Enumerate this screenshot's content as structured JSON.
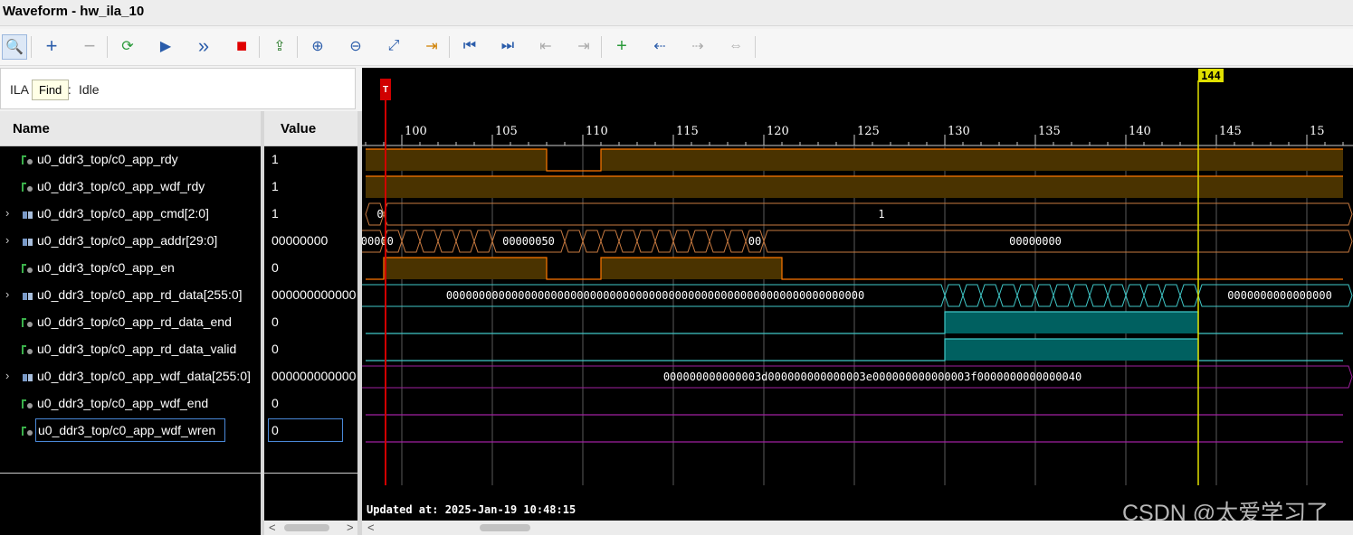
{
  "window": {
    "title": "Waveform - hw_ila_10"
  },
  "toolbar": {
    "buttons": [
      {
        "icon": "search-icon",
        "glyph": "🔍"
      },
      {
        "icon": "add-icon",
        "glyph": "+"
      },
      {
        "icon": "remove-icon",
        "glyph": "−"
      },
      {
        "icon": "run-trigger-immediate-icon",
        "glyph": "⟳"
      },
      {
        "icon": "run-icon",
        "glyph": "▶"
      },
      {
        "icon": "fast-forward-icon",
        "glyph": "»"
      },
      {
        "icon": "stop-icon",
        "glyph": "■"
      },
      {
        "icon": "export-icon",
        "glyph": "⇪"
      },
      {
        "icon": "zoom-in-icon",
        "glyph": "⊕"
      },
      {
        "icon": "zoom-out-icon",
        "glyph": "⊖"
      },
      {
        "icon": "zoom-fit-icon",
        "glyph": "⤢"
      },
      {
        "icon": "goto-cursor-icon",
        "glyph": "⇥"
      },
      {
        "icon": "goto-start-icon",
        "glyph": "⏮"
      },
      {
        "icon": "goto-end-icon",
        "glyph": "⏭"
      },
      {
        "icon": "previous-transition-icon",
        "glyph": "⇤"
      },
      {
        "icon": "next-transition-icon",
        "glyph": "⇥"
      },
      {
        "icon": "add-marker-icon",
        "glyph": "+"
      },
      {
        "icon": "previous-marker-icon",
        "glyph": "⇠"
      },
      {
        "icon": "next-marker-icon",
        "glyph": "⇢"
      },
      {
        "icon": "swap-cursors-icon",
        "glyph": "⇔"
      }
    ]
  },
  "status": {
    "label": "ILA Status:",
    "value": "Idle",
    "tooltip": "Find"
  },
  "columns": {
    "name": "Name",
    "value": "Value"
  },
  "signals": [
    {
      "name": "u0_ddr3_top/c0_app_rdy",
      "value": "1",
      "type": "bit",
      "expandable": false
    },
    {
      "name": "u0_ddr3_top/c0_app_wdf_rdy",
      "value": "1",
      "type": "bit",
      "expandable": false
    },
    {
      "name": "u0_ddr3_top/c0_app_cmd[2:0]",
      "value": "1",
      "type": "bus",
      "expandable": true
    },
    {
      "name": "u0_ddr3_top/c0_app_addr[29:0]",
      "value": "00000000",
      "type": "bus",
      "expandable": true
    },
    {
      "name": "u0_ddr3_top/c0_app_en",
      "value": "0",
      "type": "bit",
      "expandable": false
    },
    {
      "name": "u0_ddr3_top/c0_app_rd_data[255:0]",
      "value": "000000000000",
      "type": "bus",
      "expandable": true
    },
    {
      "name": "u0_ddr3_top/c0_app_rd_data_end",
      "value": "0",
      "type": "bit",
      "expandable": false
    },
    {
      "name": "u0_ddr3_top/c0_app_rd_data_valid",
      "value": "0",
      "type": "bit",
      "expandable": false
    },
    {
      "name": "u0_ddr3_top/c0_app_wdf_data[255:0]",
      "value": "000000000000",
      "type": "bus",
      "expandable": true
    },
    {
      "name": "u0_ddr3_top/c0_app_wdf_end",
      "value": "0",
      "type": "bit",
      "expandable": false
    },
    {
      "name": "u0_ddr3_top/c0_app_wdf_wren",
      "value": "0",
      "type": "bit",
      "expandable": false,
      "selected": true
    }
  ],
  "timeline": {
    "start": 98,
    "end": 152,
    "labels": [
      "100",
      "105",
      "110",
      "115",
      "120",
      "125",
      "130",
      "135",
      "140",
      "145",
      "15"
    ],
    "trigger_marker": {
      "label": "T",
      "time": 99
    },
    "cursor": {
      "label": "144",
      "time": 144
    }
  },
  "waves": {
    "c0_app_rdy": {
      "high": [
        [
          98,
          108
        ],
        [
          111,
          152
        ]
      ]
    },
    "c0_app_wdf_rdy": {
      "high": [
        [
          98,
          152
        ]
      ]
    },
    "c0_app_en": {
      "high": [
        [
          99,
          108
        ],
        [
          111,
          121
        ]
      ]
    },
    "c0_app_rd_data_end": {
      "high": [
        [
          130,
          144
        ]
      ]
    },
    "c0_app_rd_data_valid": {
      "high": [
        [
          130,
          144
        ]
      ]
    },
    "c0_app_cmd": {
      "labels": [
        "0",
        "1"
      ]
    },
    "c0_app_addr": {
      "labels": [
        "00000000",
        "00000050",
        "00",
        "00000000"
      ]
    },
    "c0_app_rd_data": {
      "labels": [
        "0000000000000000000000000000000000000000000000000000000000000000",
        "0000000000000000"
      ]
    },
    "c0_app_wdf_data": {
      "labels": [
        "000000000000003d000000000000003e000000000000003f0000000000000040"
      ]
    }
  },
  "colors": {
    "bit_signal": "#ff7700",
    "bit_fill": "#3a2a00",
    "bus": "#c87a40",
    "rd_data": "#40c8c8",
    "teal_fill": "#006060",
    "wdf_data": "#a020a0",
    "trigger": "#d00000",
    "cursor": "#e0e000"
  },
  "footer": {
    "updated": "Updated at: 2025-Jan-19 10:48:15"
  },
  "watermark": "CSDN @太爱学习了"
}
